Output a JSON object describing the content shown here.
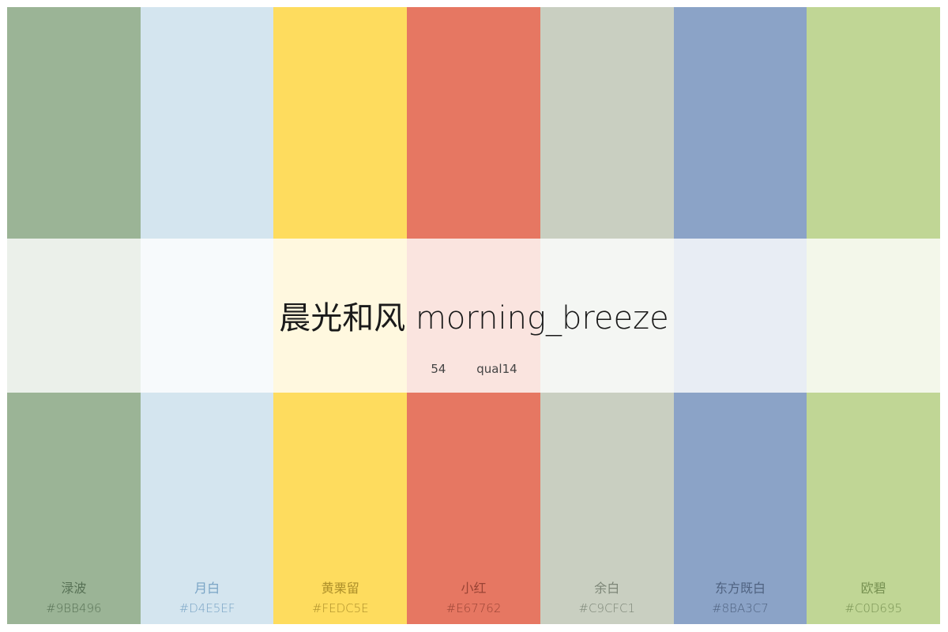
{
  "title": "晨光和风 morning_breeze",
  "meta": {
    "number": "54",
    "category": "qual14"
  },
  "swatches": [
    {
      "name": "渌波",
      "hex": "#9BB496",
      "color": "#9BB496",
      "text_color": "#1f3a1f"
    },
    {
      "name": "月白",
      "hex": "#D4E5EF",
      "color": "#D4E5EF",
      "text_color": "#2f6fa3"
    },
    {
      "name": "黄栗留",
      "hex": "#FEDC5E",
      "color": "#FEDC5E",
      "text_color": "#6b5200"
    },
    {
      "name": "小红",
      "hex": "#E67762",
      "color": "#E67762",
      "text_color": "#5a1a10"
    },
    {
      "name": "余白",
      "hex": "#C9CFC1",
      "color": "#C9CFC1",
      "text_color": "#3e4a3b"
    },
    {
      "name": "东方既白",
      "hex": "#8BA3C7",
      "color": "#8BA3C7",
      "text_color": "#1d2c45"
    },
    {
      "name": "欧碧",
      "hex": "#C0D695",
      "color": "#C0D695",
      "text_color": "#3c5a1c"
    }
  ]
}
